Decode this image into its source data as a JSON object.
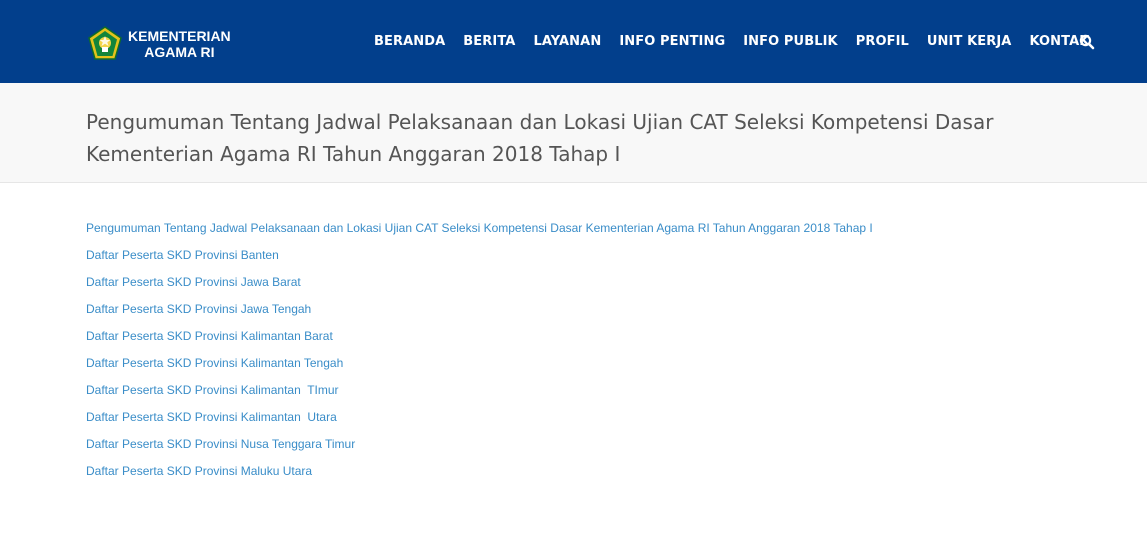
{
  "header": {
    "logo": {
      "line1": "KEMENTERIAN",
      "line2": "AGAMA RI"
    },
    "nav": [
      {
        "label": "BERANDA"
      },
      {
        "label": "BERITA"
      },
      {
        "label": "LAYANAN"
      },
      {
        "label": "INFO PENTING"
      },
      {
        "label": "INFO PUBLIK"
      },
      {
        "label": "PROFIL"
      },
      {
        "label": "UNIT KERJA"
      },
      {
        "label": "KONTAK"
      }
    ],
    "search_icon": "search-icon",
    "colors": {
      "background": "#023f8c",
      "text": "#ffffff"
    }
  },
  "page": {
    "title": "Pengumuman Tentang Jadwal Pelaksanaan dan Lokasi Ujian CAT Seleksi Kompetensi Dasar Kementerian Agama RI Tahun Anggaran 2018 Tahap I"
  },
  "content": {
    "links": [
      {
        "label": "Pengumuman Tentang Jadwal Pelaksanaan dan Lokasi Ujian CAT Seleksi Kompetensi Dasar Kementerian Agama RI Tahun Anggaran 2018 Tahap I"
      },
      {
        "label": "Daftar Peserta SKD Provinsi Banten"
      },
      {
        "label": "Daftar Peserta SKD Provinsi Jawa Barat"
      },
      {
        "label": "Daftar Peserta SKD Provinsi Jawa Tengah"
      },
      {
        "label": "Daftar Peserta SKD Provinsi Kalimantan Barat"
      },
      {
        "label": "Daftar Peserta SKD Provinsi Kalimantan Tengah"
      },
      {
        "label": "Daftar Peserta SKD Provinsi Kalimantan  TImur"
      },
      {
        "label": "Daftar Peserta SKD Provinsi Kalimantan  Utara"
      },
      {
        "label": "Daftar Peserta SKD Provinsi Nusa Tenggara Timur"
      },
      {
        "label": "Daftar Peserta SKD Provinsi Maluku Utara"
      }
    ],
    "link_color": "#3a8dc8"
  }
}
